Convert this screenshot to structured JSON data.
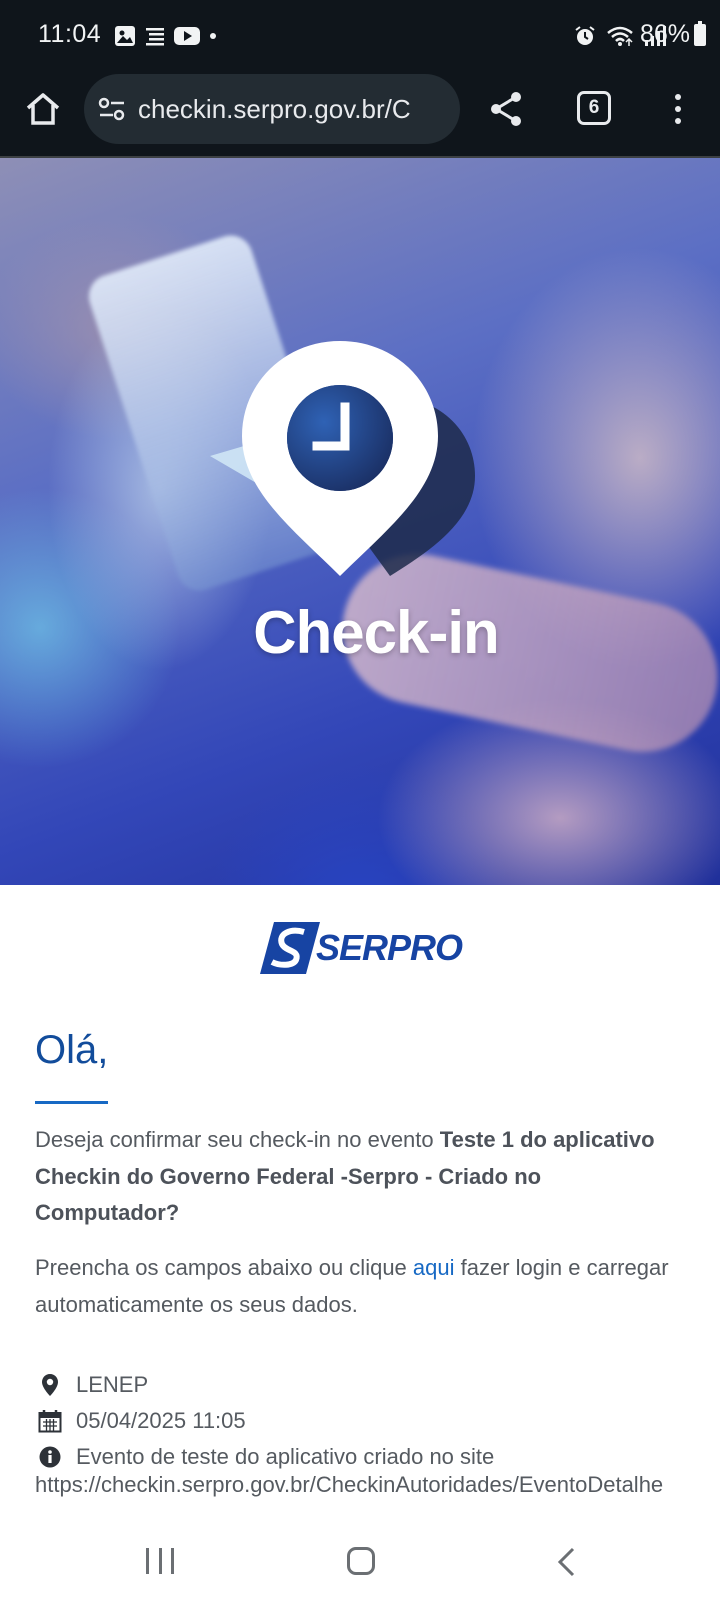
{
  "status_bar": {
    "time": "11:04",
    "battery": "86%",
    "left_icons": [
      "gallery-icon",
      "notes-icon",
      "youtube-icon",
      "dot-icon"
    ],
    "right_icons": [
      "alarm-icon",
      "wifi-icon",
      "signal-icon",
      "battery-icon"
    ]
  },
  "browser": {
    "url": "checkin.serpro.gov.br/C",
    "tab_count": "6",
    "icons": [
      "home-icon",
      "tune-icon",
      "share-icon",
      "tabs-icon",
      "menu-icon"
    ]
  },
  "hero": {
    "title": "Check-in"
  },
  "brand": {
    "logo_text": "SERPRO",
    "color": "#1744a3"
  },
  "content": {
    "greeting": "Olá,",
    "confirm_prefix": "Deseja confirmar seu check-in no evento",
    "event_name_line1": "Teste 1 do aplicativo",
    "event_name_line2": "Checkin do Governo Federal -Serpro - Criado no",
    "event_name_line3": "Computador?",
    "instructions_before": "Preencha os campos abaixo ou clique",
    "instructions_link": "aqui",
    "instructions_after": "fazer login e carregar automaticamente os seus dados.",
    "location": "LENEP",
    "datetime": "05/04/2025 11:05",
    "description_line1": "Evento de teste do aplicativo criado no site",
    "description_line2": "https://checkin.serpro.gov.br/CheckinAutoridades/EventoDetalhe"
  },
  "colors": {
    "accent": "#1769c4",
    "heading": "#124c9b",
    "toolbar_bg": "#0f151b"
  }
}
